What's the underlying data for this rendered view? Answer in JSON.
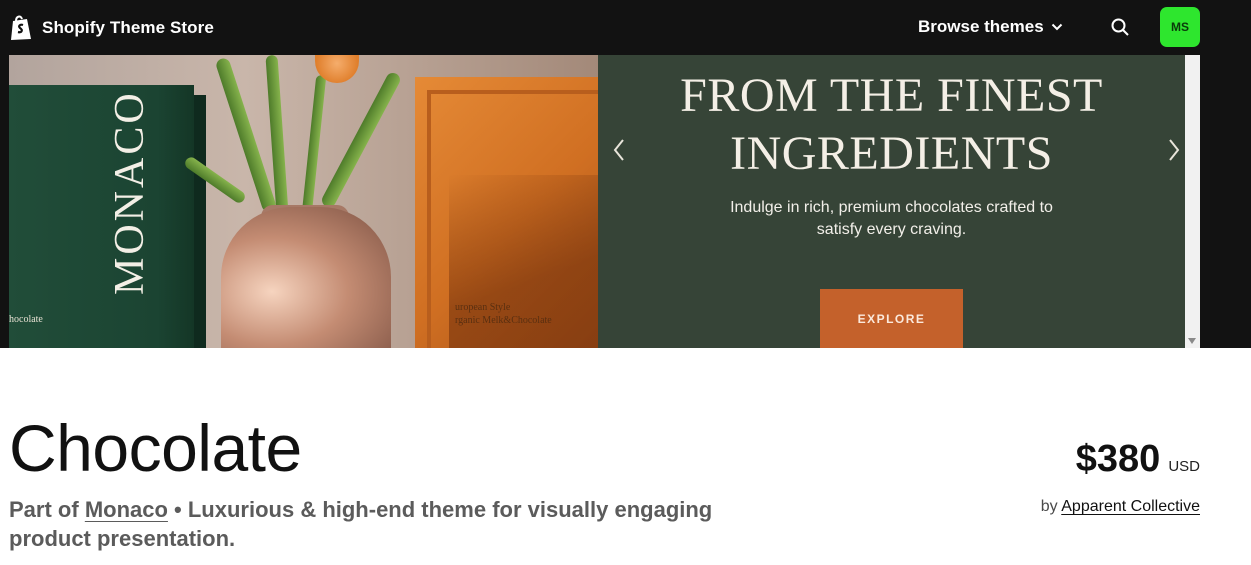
{
  "header": {
    "brand": "Shopify Theme Store",
    "browse_label": "Browse themes",
    "avatar_initials": "MS",
    "colors": {
      "bar": "#121212",
      "avatar": "#2ee62e"
    }
  },
  "preview": {
    "box_brand": "MONACO",
    "box_small_text": "hocolate",
    "orange_caption_1": "uropean Style",
    "orange_caption_2": "rganic Melk&Chocolate",
    "headline_line1": "FROM THE FINEST",
    "headline_line2": "INGREDIENTS",
    "subtext_line1": "Indulge in rich, premium chocolates crafted to",
    "subtext_line2": "satisfy every craving.",
    "cta": "EXPLORE",
    "colors": {
      "panel": "#364437",
      "cta": "#c4612b"
    }
  },
  "product": {
    "title": "Chocolate",
    "part_of_prefix": "Part of",
    "collection": "Monaco",
    "description": " • Luxurious & high-end theme for visually engaging product presentation.",
    "price": "$380",
    "currency": "USD",
    "by_prefix": "by",
    "author": "Apparent Collective"
  }
}
